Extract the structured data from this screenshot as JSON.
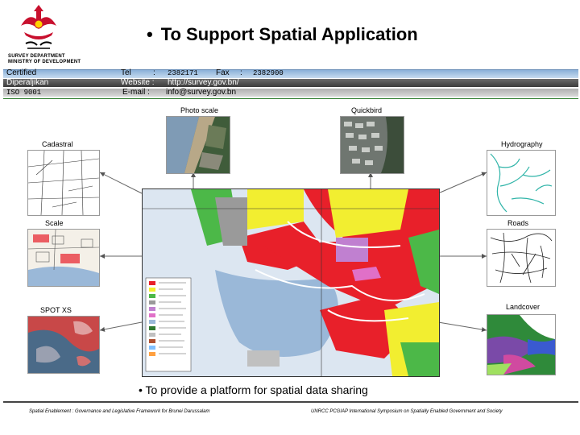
{
  "header": {
    "dept_line1": "SURVEY DEPARTMENT",
    "dept_line2": "MINISTRY OF DEVELOPMENT",
    "title_bullet": "•",
    "title": "To Support Spatial Application"
  },
  "info_bar": {
    "certified": "Certified",
    "diperaljikan": "Diperaljikan",
    "iso": "ISO 9001",
    "tel_label": "Tel",
    "tel_value": "2382171",
    "fax_label": "Fax",
    "fax_value": "2382900",
    "website_label": "Website :",
    "website_value": "http://survey.gov.bn/",
    "email_label": "E-mail :",
    "email_value": "info@survey.gov.bn"
  },
  "panels": {
    "photo_scale": "Photo scale",
    "quickbird": "Quickbird",
    "cadastral": "Cadastral",
    "hydrography": "Hydrography",
    "scale": "Scale",
    "roads": "Roads",
    "spot_xs": "SPOT XS",
    "landcover": "Landcover"
  },
  "bottom": {
    "bullet": "•",
    "text": "To provide a platform for spatial data sharing"
  },
  "footer": {
    "left": "Spatial Enablement : Governance and Legislative Framework for Brunei Darussalam",
    "right": "UNRCC PCGIAP International Symposium on Spatially Enabled Government and Society"
  },
  "colors": {
    "title_bar_blue": "#8ab0d8",
    "bar_dark": "#4a4a4a",
    "bar_grey": "#c8c8c8",
    "map_red": "#e8202a",
    "map_yellow": "#f2ee30",
    "map_green": "#4cb848",
    "map_water": "#9ab8d8"
  }
}
